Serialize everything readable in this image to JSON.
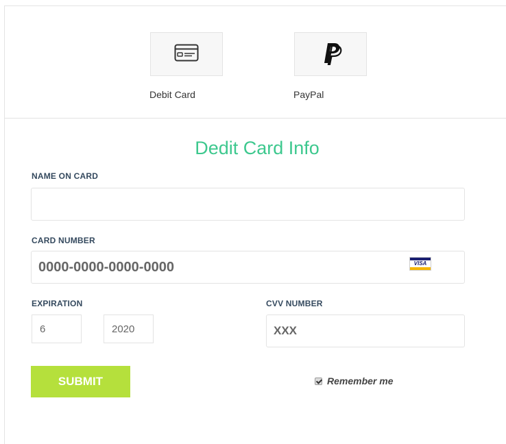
{
  "payment_methods": [
    {
      "label": "Debit Card",
      "icon": "credit-card-icon"
    },
    {
      "label": "PayPal",
      "icon": "paypal-icon"
    }
  ],
  "form": {
    "title": "Dedit Card Info",
    "name_label": "NAME ON CARD",
    "name_value": "",
    "card_number_label": "CARD NUMBER",
    "card_number_value": "0000-0000-0000-0000",
    "card_brand_icon": "visa-icon",
    "card_brand_text": "VISA",
    "expiration_label": "EXPIRATION",
    "expiration_month": "6",
    "expiration_year": "2020",
    "cvv_label": "CVV NUMBER",
    "cvv_value": "XXX",
    "submit_label": "SUBMIT",
    "remember_label": "Remember me",
    "remember_checked": true
  },
  "colors": {
    "title": "#3dc88e",
    "submit_bg": "#b5e03c",
    "label": "#34495e"
  }
}
